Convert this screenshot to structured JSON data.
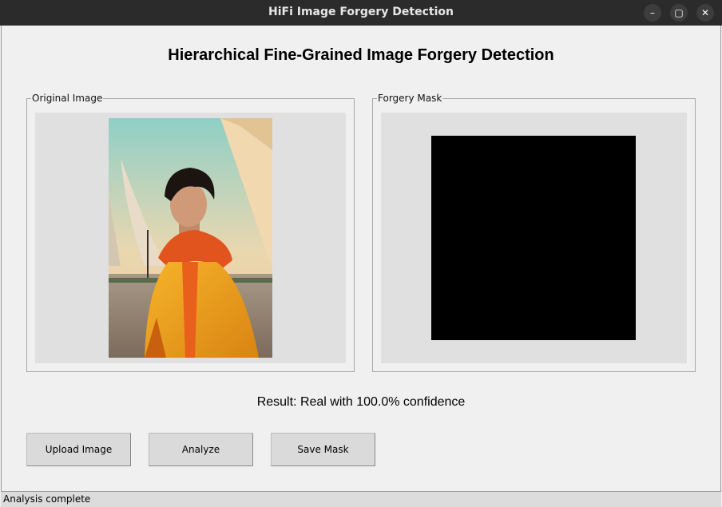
{
  "window": {
    "title": "HiFi Image Forgery Detection",
    "controls": {
      "minimize": "–",
      "maximize": "▢",
      "close": "✕"
    }
  },
  "heading": "Hierarchical Fine-Grained Image Forgery Detection",
  "panels": {
    "original": {
      "label": "Original Image"
    },
    "mask": {
      "label": "Forgery Mask"
    }
  },
  "result": "Result: Real with 100.0% confidence",
  "buttons": {
    "upload": "Upload Image",
    "analyze": "Analyze",
    "save": "Save Mask"
  },
  "status": "Analysis complete",
  "colors": {
    "titlebar": "#2b2b2b",
    "mask_fill": "#000000",
    "jacket": "#f0a020"
  }
}
